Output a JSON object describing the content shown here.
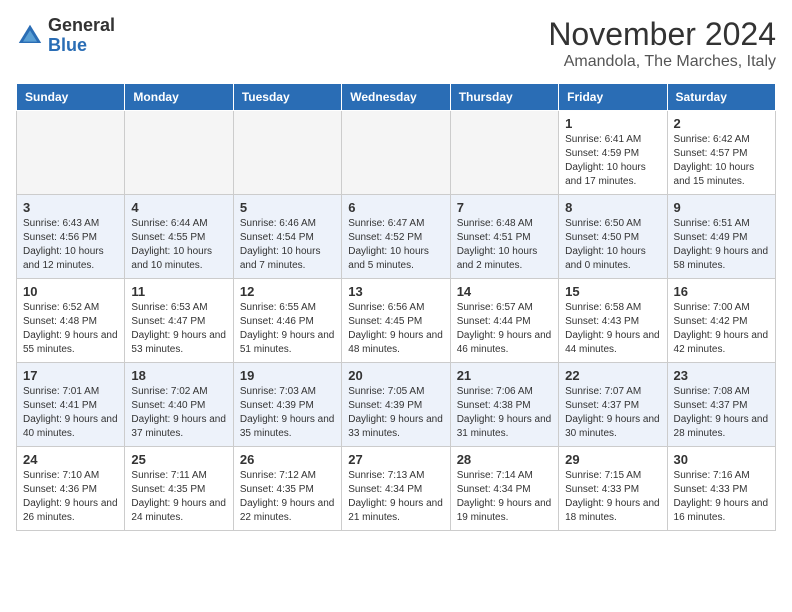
{
  "header": {
    "logo": {
      "general": "General",
      "blue": "Blue"
    },
    "title": "November 2024",
    "subtitle": "Amandola, The Marches, Italy"
  },
  "weekdays": [
    "Sunday",
    "Monday",
    "Tuesday",
    "Wednesday",
    "Thursday",
    "Friday",
    "Saturday"
  ],
  "weeks": [
    [
      {
        "day": "",
        "info": ""
      },
      {
        "day": "",
        "info": ""
      },
      {
        "day": "",
        "info": ""
      },
      {
        "day": "",
        "info": ""
      },
      {
        "day": "",
        "info": ""
      },
      {
        "day": "1",
        "info": "Sunrise: 6:41 AM\nSunset: 4:59 PM\nDaylight: 10 hours and 17 minutes."
      },
      {
        "day": "2",
        "info": "Sunrise: 6:42 AM\nSunset: 4:57 PM\nDaylight: 10 hours and 15 minutes."
      }
    ],
    [
      {
        "day": "3",
        "info": "Sunrise: 6:43 AM\nSunset: 4:56 PM\nDaylight: 10 hours and 12 minutes."
      },
      {
        "day": "4",
        "info": "Sunrise: 6:44 AM\nSunset: 4:55 PM\nDaylight: 10 hours and 10 minutes."
      },
      {
        "day": "5",
        "info": "Sunrise: 6:46 AM\nSunset: 4:54 PM\nDaylight: 10 hours and 7 minutes."
      },
      {
        "day": "6",
        "info": "Sunrise: 6:47 AM\nSunset: 4:52 PM\nDaylight: 10 hours and 5 minutes."
      },
      {
        "day": "7",
        "info": "Sunrise: 6:48 AM\nSunset: 4:51 PM\nDaylight: 10 hours and 2 minutes."
      },
      {
        "day": "8",
        "info": "Sunrise: 6:50 AM\nSunset: 4:50 PM\nDaylight: 10 hours and 0 minutes."
      },
      {
        "day": "9",
        "info": "Sunrise: 6:51 AM\nSunset: 4:49 PM\nDaylight: 9 hours and 58 minutes."
      }
    ],
    [
      {
        "day": "10",
        "info": "Sunrise: 6:52 AM\nSunset: 4:48 PM\nDaylight: 9 hours and 55 minutes."
      },
      {
        "day": "11",
        "info": "Sunrise: 6:53 AM\nSunset: 4:47 PM\nDaylight: 9 hours and 53 minutes."
      },
      {
        "day": "12",
        "info": "Sunrise: 6:55 AM\nSunset: 4:46 PM\nDaylight: 9 hours and 51 minutes."
      },
      {
        "day": "13",
        "info": "Sunrise: 6:56 AM\nSunset: 4:45 PM\nDaylight: 9 hours and 48 minutes."
      },
      {
        "day": "14",
        "info": "Sunrise: 6:57 AM\nSunset: 4:44 PM\nDaylight: 9 hours and 46 minutes."
      },
      {
        "day": "15",
        "info": "Sunrise: 6:58 AM\nSunset: 4:43 PM\nDaylight: 9 hours and 44 minutes."
      },
      {
        "day": "16",
        "info": "Sunrise: 7:00 AM\nSunset: 4:42 PM\nDaylight: 9 hours and 42 minutes."
      }
    ],
    [
      {
        "day": "17",
        "info": "Sunrise: 7:01 AM\nSunset: 4:41 PM\nDaylight: 9 hours and 40 minutes."
      },
      {
        "day": "18",
        "info": "Sunrise: 7:02 AM\nSunset: 4:40 PM\nDaylight: 9 hours and 37 minutes."
      },
      {
        "day": "19",
        "info": "Sunrise: 7:03 AM\nSunset: 4:39 PM\nDaylight: 9 hours and 35 minutes."
      },
      {
        "day": "20",
        "info": "Sunrise: 7:05 AM\nSunset: 4:39 PM\nDaylight: 9 hours and 33 minutes."
      },
      {
        "day": "21",
        "info": "Sunrise: 7:06 AM\nSunset: 4:38 PM\nDaylight: 9 hours and 31 minutes."
      },
      {
        "day": "22",
        "info": "Sunrise: 7:07 AM\nSunset: 4:37 PM\nDaylight: 9 hours and 30 minutes."
      },
      {
        "day": "23",
        "info": "Sunrise: 7:08 AM\nSunset: 4:37 PM\nDaylight: 9 hours and 28 minutes."
      }
    ],
    [
      {
        "day": "24",
        "info": "Sunrise: 7:10 AM\nSunset: 4:36 PM\nDaylight: 9 hours and 26 minutes."
      },
      {
        "day": "25",
        "info": "Sunrise: 7:11 AM\nSunset: 4:35 PM\nDaylight: 9 hours and 24 minutes."
      },
      {
        "day": "26",
        "info": "Sunrise: 7:12 AM\nSunset: 4:35 PM\nDaylight: 9 hours and 22 minutes."
      },
      {
        "day": "27",
        "info": "Sunrise: 7:13 AM\nSunset: 4:34 PM\nDaylight: 9 hours and 21 minutes."
      },
      {
        "day": "28",
        "info": "Sunrise: 7:14 AM\nSunset: 4:34 PM\nDaylight: 9 hours and 19 minutes."
      },
      {
        "day": "29",
        "info": "Sunrise: 7:15 AM\nSunset: 4:33 PM\nDaylight: 9 hours and 18 minutes."
      },
      {
        "day": "30",
        "info": "Sunrise: 7:16 AM\nSunset: 4:33 PM\nDaylight: 9 hours and 16 minutes."
      }
    ]
  ]
}
